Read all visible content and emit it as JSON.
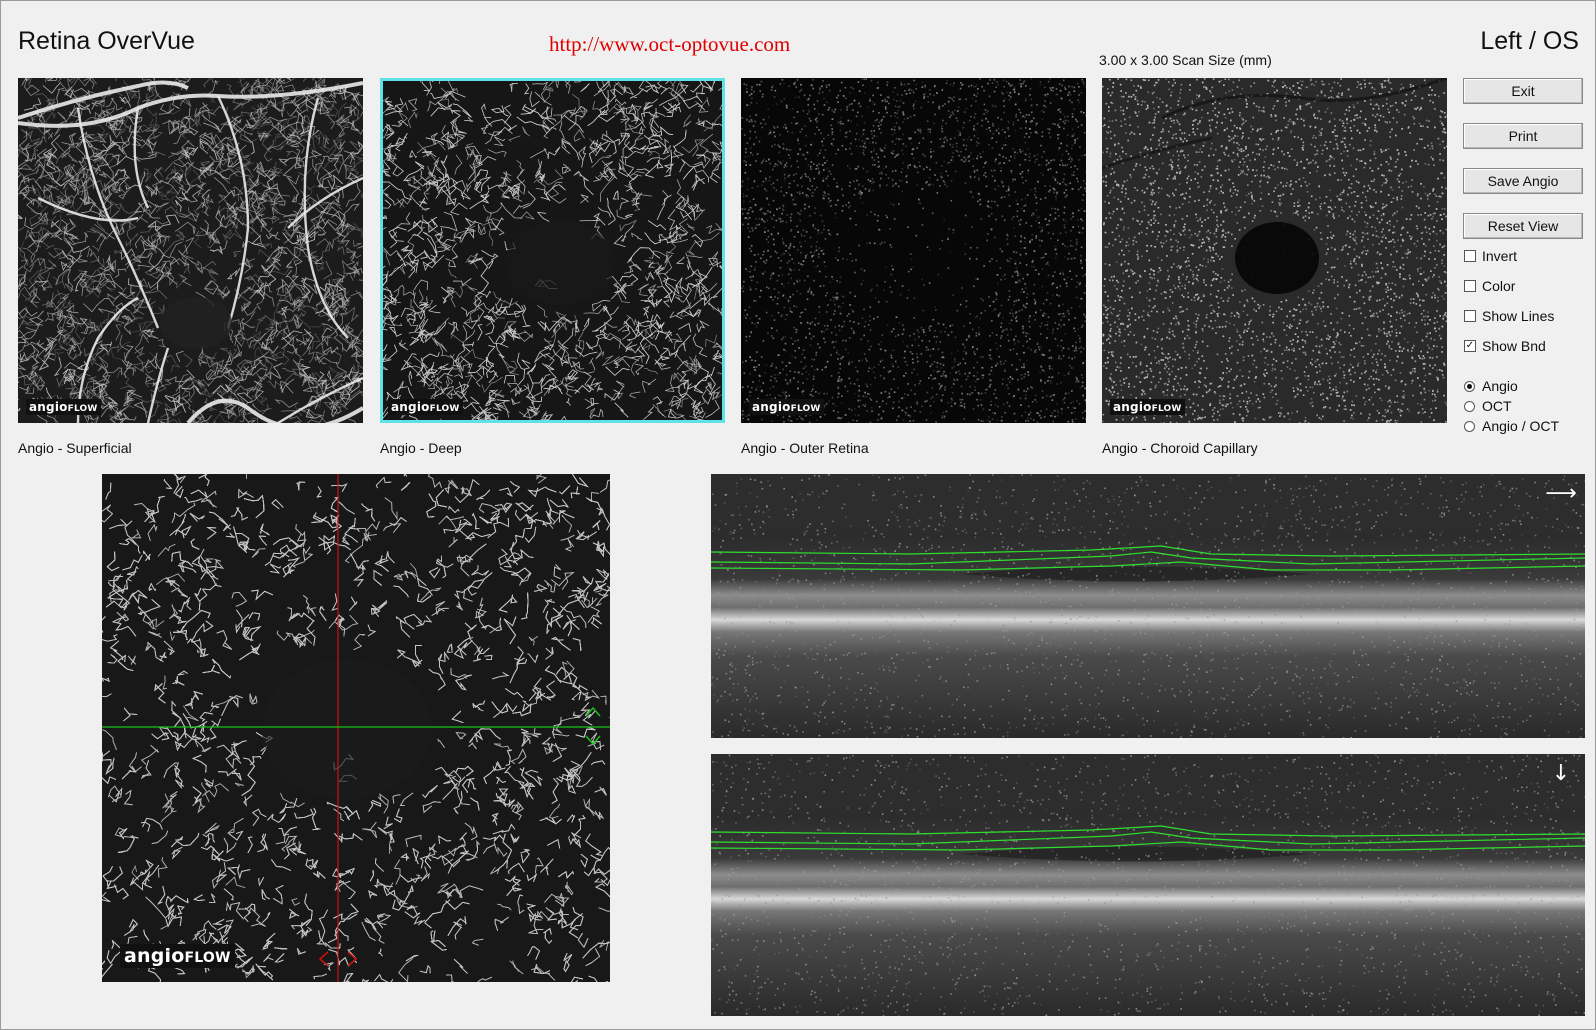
{
  "header": {
    "app_title": "Retina OverVue",
    "url": "http://www.oct-optovue.com",
    "eye": "Left / OS",
    "scan_size": "3.00 x 3.00 Scan Size (mm)"
  },
  "thumbnails": [
    {
      "label": "Angio - Superficial",
      "logo_main": "angio",
      "logo_sub": "FLOW",
      "selected": false
    },
    {
      "label": "Angio - Deep",
      "logo_main": "angio",
      "logo_sub": "FLOW",
      "selected": true
    },
    {
      "label": "Angio - Outer Retina",
      "logo_main": "angio",
      "logo_sub": "FLOW",
      "selected": false
    },
    {
      "label": "Angio - Choroid Capillary",
      "logo_main": "angio",
      "logo_sub": "FLOW",
      "selected": false
    }
  ],
  "buttons": {
    "exit": "Exit",
    "print": "Print",
    "save_angio": "Save Angio",
    "reset_view": "Reset View"
  },
  "checkboxes": [
    {
      "label": "Invert",
      "checked": false
    },
    {
      "label": "Color",
      "checked": false
    },
    {
      "label": "Show Lines",
      "checked": false
    },
    {
      "label": "Show Bnd",
      "checked": true
    }
  ],
  "view_mode": {
    "options": [
      "Angio",
      "OCT",
      "Angio / OCT"
    ],
    "selected": "Angio"
  },
  "enface": {
    "logo_main": "angio",
    "logo_sub": "FLOW"
  },
  "colors": {
    "selection_outline": "#5fe2e6",
    "url_text": "#e00000",
    "crosshair_vertical": "#d01010",
    "crosshair_horizontal": "#18c018",
    "boundary_lines": "#2ee02e"
  },
  "icons": {
    "bscan_top_direction": "arrow-right-icon",
    "bscan_bottom_direction": "arrow-down-icon",
    "horizontal_line_handle": "green-chevron-up-down-icon",
    "vertical_line_handle": "red-chevron-left-right-icon"
  }
}
